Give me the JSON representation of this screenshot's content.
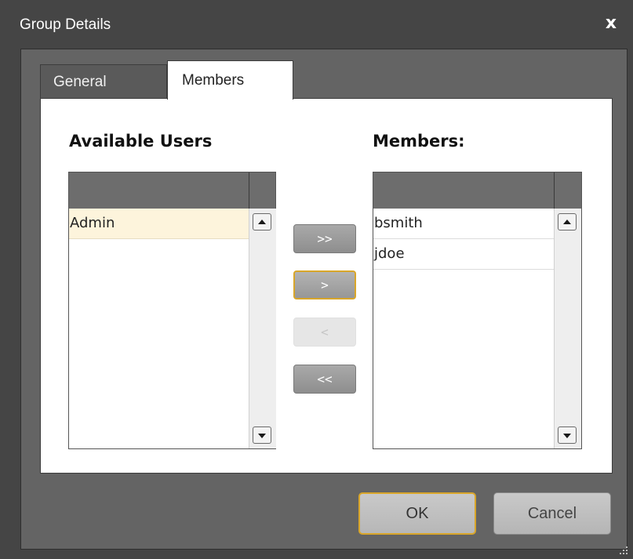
{
  "window": {
    "title": "Group Details",
    "close_glyph": "x"
  },
  "tabs": [
    {
      "label": "General",
      "active": false
    },
    {
      "label": "Members",
      "active": true
    }
  ],
  "available": {
    "heading": "Available Users",
    "items": [
      "Admin"
    ],
    "selected_index": 0
  },
  "members": {
    "heading": "Members:",
    "items": [
      "bsmith",
      "jdoe"
    ]
  },
  "move_buttons": {
    "add_all": ">>",
    "add": ">",
    "remove": "<",
    "remove_all": "<<"
  },
  "dialog_buttons": {
    "ok": "OK",
    "cancel": "Cancel"
  },
  "colors": {
    "window_bg": "#454545",
    "frame_bg": "#646464",
    "focus_accent": "#d9a62a",
    "selection": "#fdf4dc"
  },
  "icons": [
    "close-icon",
    "scroll-up-icon",
    "scroll-down-icon",
    "resize-grip-icon"
  ]
}
